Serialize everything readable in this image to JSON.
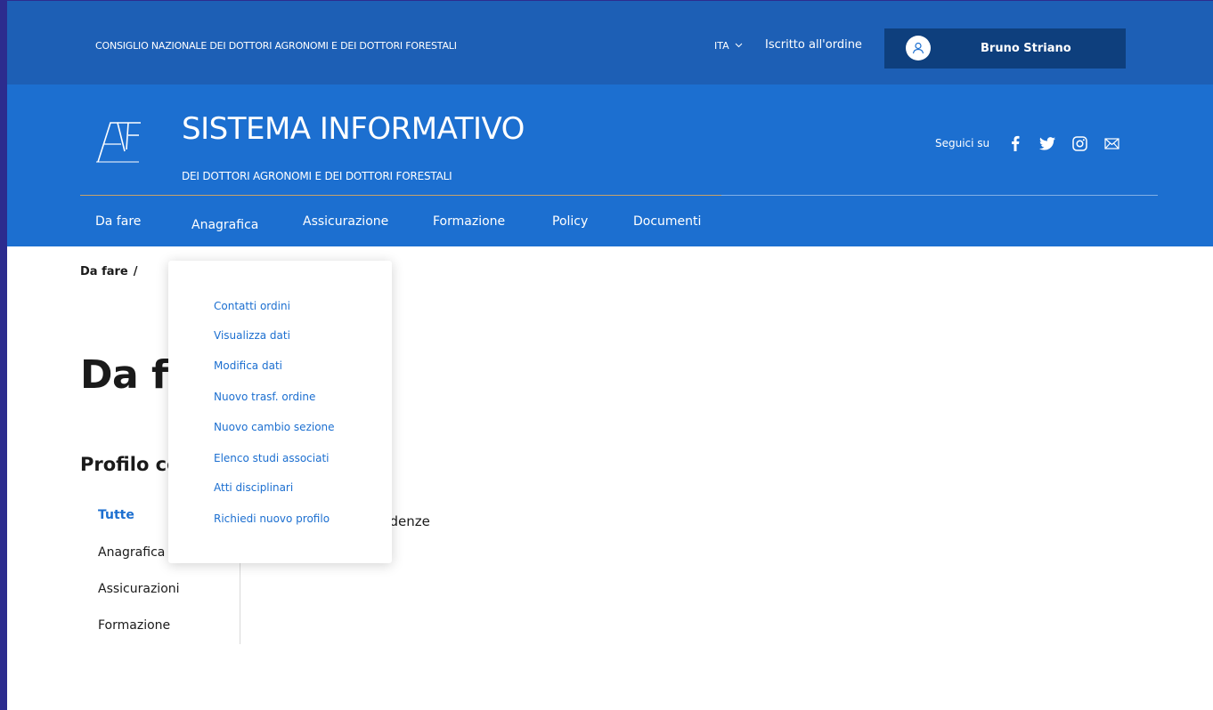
{
  "topbar": {
    "org_name": "CONSIGLIO NAZIONALE DEI DOTTORI AGRONOMI E DEI DOTTORI FORESTALI",
    "language": "ITA",
    "subscribed_label": "Iscritto all'ordine",
    "user_name": "Bruno Striano"
  },
  "header": {
    "title": "SISTEMA INFORMATIVO",
    "subtitle": "DEI DOTTORI AGRONOMI E DEI DOTTORI FORESTALI",
    "follow_label": "Seguici su",
    "social_icons": [
      "facebook-icon",
      "twitter-icon",
      "instagram-icon",
      "mail-icon"
    ]
  },
  "nav": {
    "items": [
      "Da fare",
      "Anagrafica",
      "Assicurazione",
      "Formazione",
      "Policy",
      "Documenti"
    ]
  },
  "dropdown": {
    "items": [
      "Contatti ordini",
      "Visualizza dati",
      "Modifica dati",
      "Nuovo trasf. ordine",
      "Nuovo cambio sezione",
      "Elenco studi associati",
      "Atti disciplinari",
      "Richiedi nuovo profilo"
    ]
  },
  "breadcrumb": {
    "current": "Da fare",
    "separator": "/"
  },
  "main": {
    "page_title": "Da fa",
    "section_title": "Profilo co",
    "behind_text": "ndenze",
    "side_items": [
      "Tutte",
      "Anagrafica",
      "Assicurazioni",
      "Formazione"
    ]
  },
  "colors": {
    "topbar": "#1d5fb5",
    "header": "#1c6fd0",
    "user_box": "#0e3f7d",
    "link": "#1c6fd0"
  }
}
